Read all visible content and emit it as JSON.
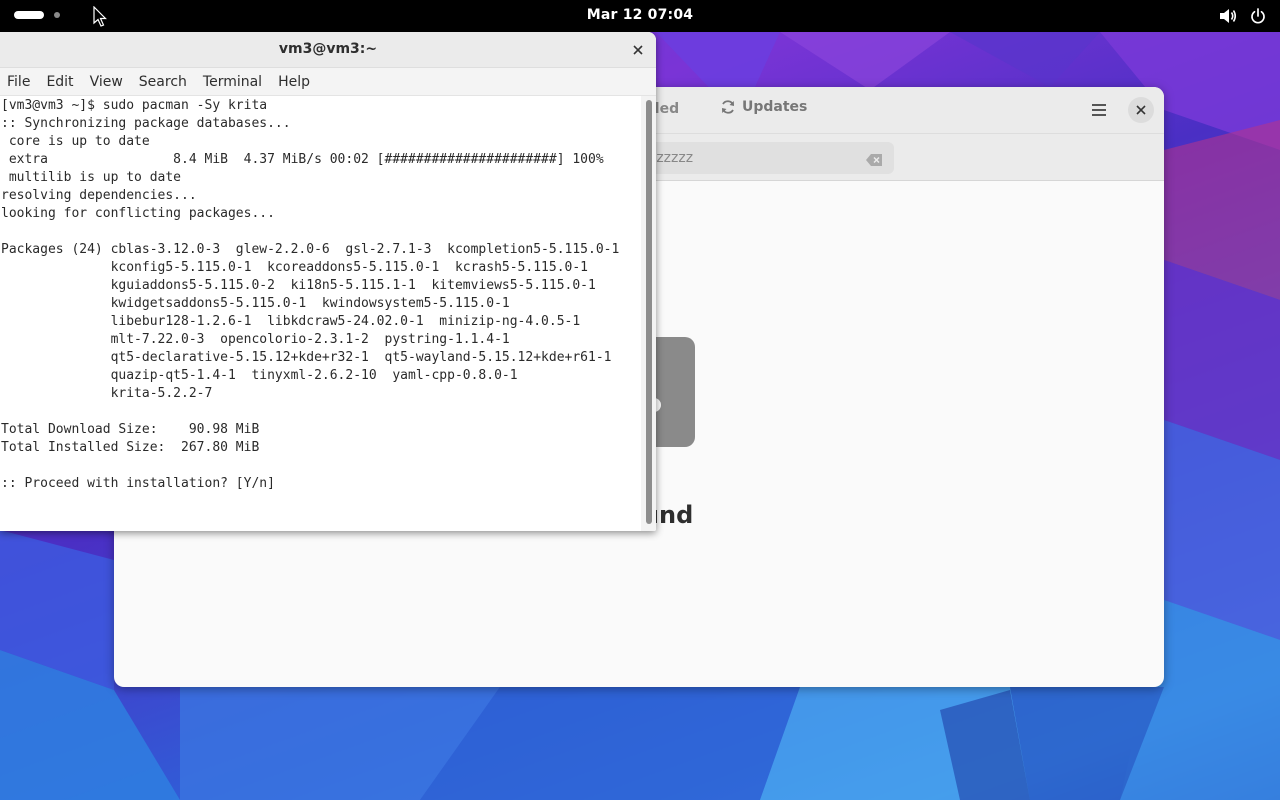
{
  "topbar": {
    "clock": "Mar 12  07:04"
  },
  "software": {
    "tab_installed": "lled",
    "tab_updates": "Updates",
    "search_text": "zzzzzzzzzzzzzzzzzzzzzzzzzz",
    "empty_text": "Found"
  },
  "terminal": {
    "title": "vm3@vm3:~",
    "close_glyph": "×",
    "menu": [
      "File",
      "Edit",
      "View",
      "Search",
      "Terminal",
      "Help"
    ],
    "lines": [
      "[vm3@vm3 ~]$ sudo pacman -Sy krita",
      ":: Synchronizing package databases...",
      " core is up to date",
      " extra                8.4 MiB  4.37 MiB/s 00:02 [######################] 100%",
      " multilib is up to date",
      "resolving dependencies...",
      "looking for conflicting packages...",
      "",
      "Packages (24) cblas-3.12.0-3  glew-2.2.0-6  gsl-2.7.1-3  kcompletion5-5.115.0-1",
      "              kconfig5-5.115.0-1  kcoreaddons5-5.115.0-1  kcrash5-5.115.0-1",
      "              kguiaddons5-5.115.0-2  ki18n5-5.115.1-1  kitemviews5-5.115.0-1",
      "              kwidgetsaddons5-5.115.0-1  kwindowsystem5-5.115.0-1",
      "              libebur128-1.2.6-1  libkdcraw5-24.02.0-1  minizip-ng-4.0.5-1",
      "              mlt-7.22.0-3  opencolorio-2.3.1-2  pystring-1.1.4-1",
      "              qt5-declarative-5.15.12+kde+r32-1  qt5-wayland-5.15.12+kde+r61-1",
      "              quazip-qt5-1.4-1  tinyxml-2.6.2-10  yaml-cpp-0.8.0-1",
      "              krita-5.2.2-7",
      "",
      "Total Download Size:    90.98 MiB",
      "Total Installed Size:  267.80 MiB",
      "",
      ":: Proceed with installation? [Y/n]"
    ]
  },
  "icons": {
    "volume": "volume-icon",
    "power": "power-icon",
    "refresh": "refresh-icon",
    "menu": "hamburger-menu-icon",
    "clear": "clear-search-icon",
    "cursor": "mouse-cursor-icon"
  },
  "colors": {
    "topbar": "#000000",
    "terminal_bg": "#ffffff",
    "titlebar": "#ebebeb"
  }
}
